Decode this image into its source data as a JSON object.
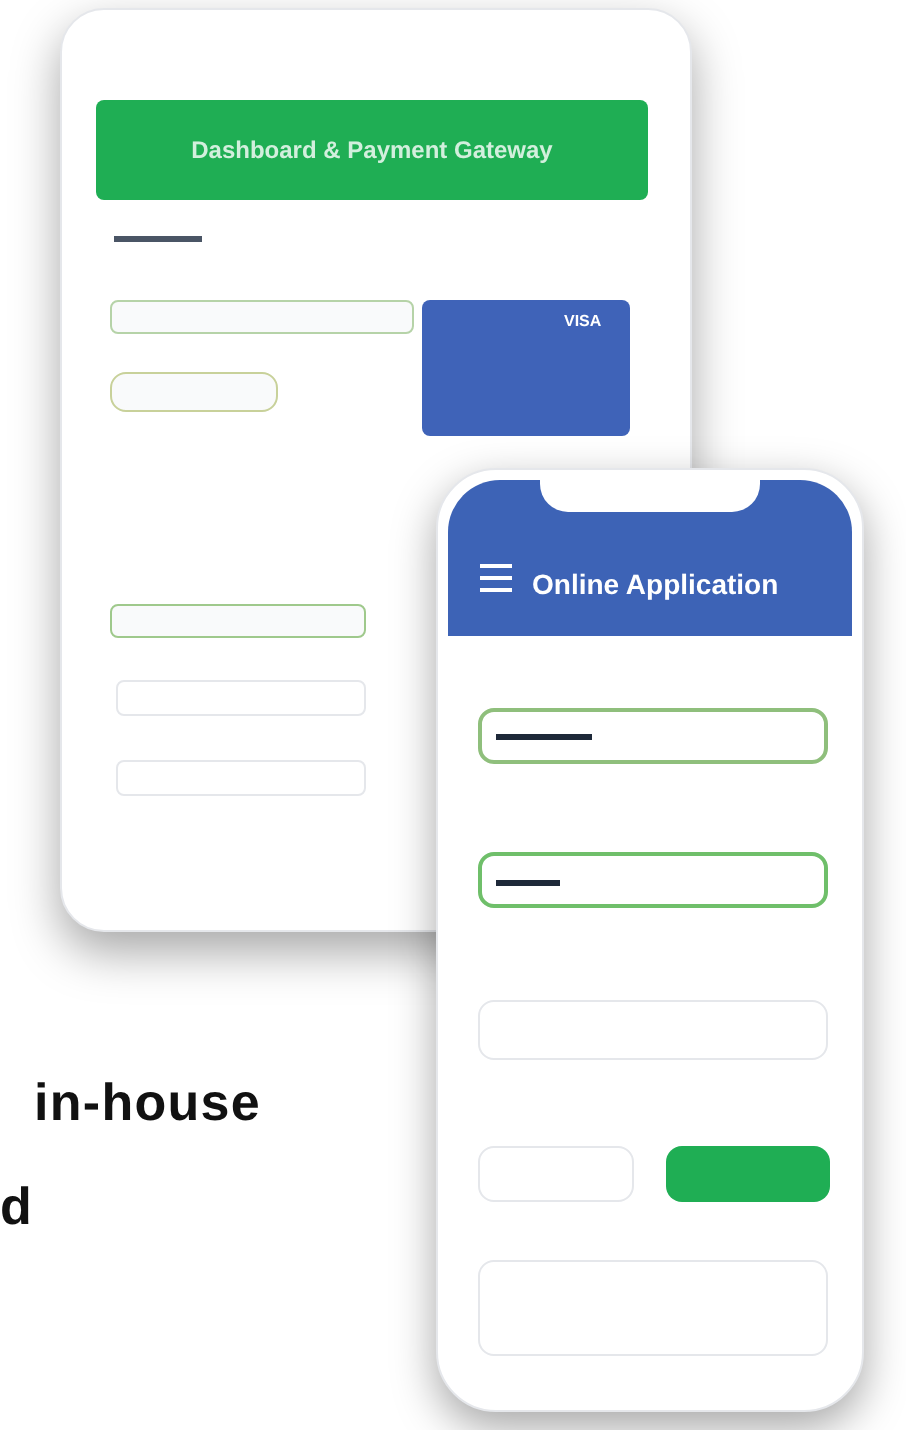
{
  "tablet": {
    "header_title": "Dashboard & Payment Gateway",
    "card_brand": "VISA"
  },
  "phone": {
    "title": "Online Application"
  },
  "text_lines": [
    "in-house",
    "d"
  ]
}
